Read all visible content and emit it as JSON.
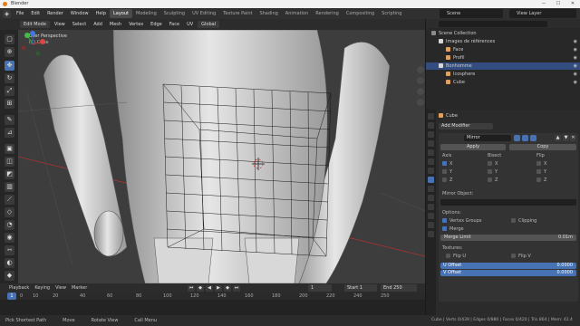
{
  "window": {
    "title": "Blender",
    "controls": [
      "—",
      "☐",
      "✕"
    ]
  },
  "menus": [
    "File",
    "Edit",
    "Render",
    "Window",
    "Help"
  ],
  "workspaces": [
    {
      "label": "Layout",
      "active": true
    },
    {
      "label": "Modeling",
      "active": false
    },
    {
      "label": "Sculpting",
      "active": false
    },
    {
      "label": "UV Editing",
      "active": false
    },
    {
      "label": "Texture Paint",
      "active": false
    },
    {
      "label": "Shading",
      "active": false
    },
    {
      "label": "Animation",
      "active": false
    },
    {
      "label": "Rendering",
      "active": false
    },
    {
      "label": "Compositing",
      "active": false
    },
    {
      "label": "Scripting",
      "active": false
    }
  ],
  "scene": {
    "label": "Scene"
  },
  "view_layer": {
    "label": "View Layer"
  },
  "viewport_header": {
    "mode": "Edit Mode",
    "menus": [
      "View",
      "Select",
      "Add",
      "Mesh",
      "Vertex",
      "Edge",
      "Face",
      "UV"
    ],
    "orientation": "Global"
  },
  "viewport": {
    "title": "User Perspective",
    "subtitle": "(1) Cube"
  },
  "timeline": {
    "menus": [
      "Playback",
      "Keying",
      "View",
      "Marker"
    ],
    "current_frame": "1",
    "start_label": "Start",
    "start_value": "1",
    "end_label": "End",
    "end_value": "250",
    "ticks": [
      "0",
      "10",
      "20",
      "40",
      "60",
      "80",
      "100",
      "120",
      "140",
      "160",
      "180",
      "200",
      "220",
      "240",
      "250"
    ],
    "frame_badge": "1"
  },
  "statusbar": {
    "items": [
      "Pick Shortest Path",
      "Move",
      "Rotate View",
      "Call Menu"
    ],
    "stats": "Cube | Verts 0/439 | Edges 0/880 | Faces 0/420 | Tris 864 | Mem: 42.4 MB | v2.80.75"
  },
  "outliner": {
    "rows": [
      {
        "label": "Scene Collection",
        "selected": false,
        "color": "#8a8a8a"
      },
      {
        "label": "Images de références",
        "selected": false,
        "color": "#d8d8d8"
      },
      {
        "label": "Face",
        "selected": false,
        "color": "#e0a060"
      },
      {
        "label": "Profil",
        "selected": false,
        "color": "#e0a060"
      },
      {
        "label": "Bonhomme",
        "selected": true,
        "color": "#d8d8d8"
      },
      {
        "label": "Icosphere",
        "selected": false,
        "color": "#e0a060"
      },
      {
        "label": "Cube",
        "selected": false,
        "color": "#e0a060"
      }
    ]
  },
  "properties": {
    "object_name": "Cube",
    "add_modifier": "Add Modifier",
    "modifier_name": "Mirror",
    "apply": "Apply",
    "copy": "Copy",
    "axis_label": "Axis",
    "bisect_label": "Bisect",
    "flip_label": "Flip",
    "axes": [
      "X",
      "Y",
      "Z"
    ],
    "axis_checked": [
      true,
      false,
      false
    ],
    "mirror_object_label": "Mirror Object:",
    "options_label": "Options:",
    "vertex_groups": "Vertex Groups",
    "clipping": "Clipping",
    "merge": "Merge",
    "merge_limit_label": "Merge Limit",
    "merge_limit_value": "0.01m",
    "textures_label": "Textures:",
    "flip_u": "Flip U",
    "flip_v": "Flip V",
    "u_offset_label": "U Offset",
    "u_offset_value": "0.0000",
    "v_offset_label": "V Offset",
    "v_offset_value": "0.0000"
  },
  "colors": {
    "accent": "#4772b3",
    "selected_row": "#334d80",
    "viewport_bg": "#3d3d3d"
  }
}
